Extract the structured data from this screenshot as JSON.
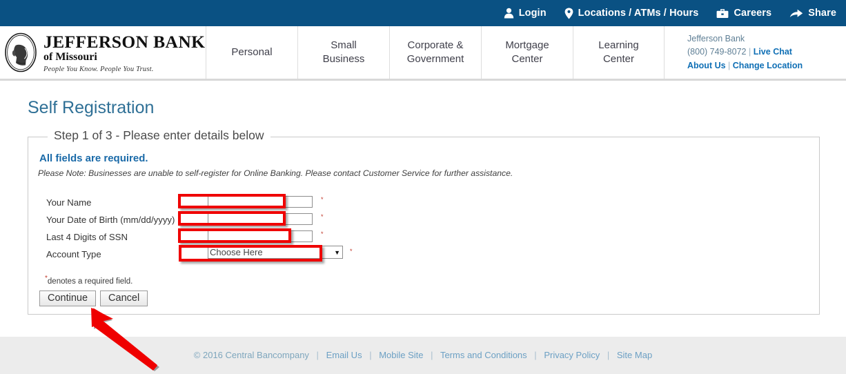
{
  "utility_bar": {
    "items": [
      {
        "label": "Login",
        "icon": "user-icon"
      },
      {
        "label": "Locations / ATMs / Hours",
        "icon": "map-pin-icon"
      },
      {
        "label": "Careers",
        "icon": "briefcase-icon"
      },
      {
        "label": "Share",
        "icon": "share-arrow-icon"
      }
    ],
    "background_color": "#0a5183",
    "text_color": "#ffffff"
  },
  "brand": {
    "line1": "JEFFERSON BANK",
    "line2": "of Missouri",
    "tagline": "People You Know. People You Trust.",
    "seal_icon": "jefferson-portrait-seal-icon"
  },
  "main_nav": {
    "items": [
      {
        "label": "Personal"
      },
      {
        "label_line1": "Small",
        "label_line2": "Business"
      },
      {
        "label_line1": "Corporate &",
        "label_line2": "Government"
      },
      {
        "label_line1": "Mortgage",
        "label_line2": "Center"
      },
      {
        "label_line1": "Learning",
        "label_line2": "Center"
      }
    ]
  },
  "contact": {
    "bank_name": "Jefferson Bank",
    "phone": "(800) 749-8072",
    "live_chat": "Live Chat",
    "about_us": "About Us",
    "change_location": "Change Location",
    "separator": "|",
    "link_color": "#0f6fb5"
  },
  "page": {
    "title": "Self Registration",
    "title_color": "#2f7096"
  },
  "form": {
    "legend": "Step 1 of 3 - Please enter details below",
    "required_heading": "All fields are required.",
    "note": "Please Note: Businesses are unable to self-register for Online Banking. Please contact Customer Service for further assistance.",
    "fields": [
      {
        "label": "Your Name",
        "type": "text",
        "value": "",
        "placeholder": "",
        "required_marker": "*"
      },
      {
        "label": "Your Date of Birth (mm/dd/yyyy)",
        "type": "text",
        "value": "",
        "placeholder": "",
        "required_marker": "*"
      },
      {
        "label": "Last 4 Digits of SSN",
        "type": "text",
        "value": "",
        "placeholder": "",
        "required_marker": "*"
      },
      {
        "label": "Account Type",
        "type": "select",
        "value": "Choose Here",
        "required_marker": "*"
      }
    ],
    "denotes_marker": "*",
    "denotes_text": "denotes a required field.",
    "continue_label": "Continue",
    "cancel_label": "Cancel"
  },
  "footer": {
    "copyright": "© 2016 Central Bancompany",
    "links": [
      {
        "label": "Email Us"
      },
      {
        "label": "Mobile Site"
      },
      {
        "label": "Terms and Conditions"
      },
      {
        "label": "Privacy Policy"
      },
      {
        "label": "Site Map"
      }
    ],
    "separator": "|",
    "background_color": "#ececec",
    "link_color": "#6ca0c4"
  },
  "annotations": {
    "highlight_color": "#ef0000",
    "arrow_target": "continue-button",
    "boxes": [
      {
        "target": "your-name-field"
      },
      {
        "target": "date-of-birth-field"
      },
      {
        "target": "ssn-last4-field"
      },
      {
        "target": "account-type-select"
      }
    ]
  }
}
